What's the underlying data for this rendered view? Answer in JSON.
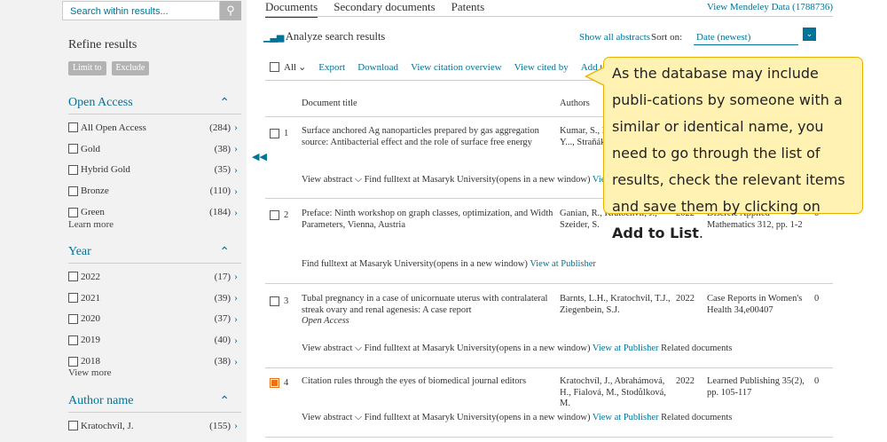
{
  "sidebar": {
    "search_placeholder": "Search within results...",
    "search_icon": "search-icon",
    "refine_title": "Refine results",
    "limit_to": "Limit to",
    "exclude": "Exclude",
    "open_access": {
      "title": "Open Access",
      "items": [
        {
          "label": "All Open Access",
          "count": "(284)"
        },
        {
          "label": "Gold",
          "count": "(38)"
        },
        {
          "label": "Hybrid Gold",
          "count": "(35)"
        },
        {
          "label": "Bronze",
          "count": "(110)"
        },
        {
          "label": "Green",
          "count": "(184)"
        }
      ],
      "more": "Learn more"
    },
    "year": {
      "title": "Year",
      "items": [
        {
          "label": "2022",
          "count": "(17)"
        },
        {
          "label": "2021",
          "count": "(39)"
        },
        {
          "label": "2020",
          "count": "(37)"
        },
        {
          "label": "2019",
          "count": "(40)"
        },
        {
          "label": "2018",
          "count": "(38)"
        }
      ],
      "more": "View more"
    },
    "author": {
      "title": "Author name",
      "items": [
        {
          "label": "Kratochvíl, J.",
          "count": "(155)"
        }
      ]
    }
  },
  "tabs": {
    "documents": "Documents",
    "secondary": "Secondary documents",
    "patents": "Patents",
    "mendeley": "View Mendeley Data (1788736)"
  },
  "analyze": "Analyze search results",
  "show_abstracts": "Show all abstracts",
  "sort_label": "Sort on:",
  "sort_value": "Date (newest)",
  "toolbar": {
    "all": "All",
    "export": "Export",
    "download": "Download",
    "citation_overview": "View citation overview",
    "cited_by": "View cited by",
    "add_to_list": "Add to List"
  },
  "columns": {
    "title": "Document title",
    "authors": "Authors"
  },
  "results": [
    {
      "num": "1",
      "title": "Surface anchored Ag nanoparticles prepared by gas aggregation source: Antibacterial effect and the role of surface free energy",
      "authors": "Kumar, S., Kr..., Mukhkrabi, Y..., Straňák, V.",
      "links": "View abstract ⌵  Find fulltext at Masaryk University(opens in a new window)",
      "link_view_pub": "View at P"
    },
    {
      "num": "2",
      "title": "Preface: Ninth workshop on graph classes, optimization, and Width Parameters, Vienna, Austria",
      "authors": "Ganian, R., Kratochvíl, J., Szeider, S.",
      "year": "2022",
      "source": "Discrete Applied Mathematics 312, pp. 1-2",
      "cited": "0",
      "links": "Find fulltext at Masaryk University(opens in a new window)",
      "link_view_pub": "View at Publisher"
    },
    {
      "num": "3",
      "title": "Tubal pregnancy in a case of unicornuate uterus with contralateral streak ovary and renal agenesis: A case report",
      "open_access": "Open Access",
      "authors": "Barnts, L.H., Kratochvil, T.J., Ziegenbein, S.J.",
      "year": "2022",
      "source": "Case Reports in Women's Health 34,e00407",
      "cited": "0",
      "links": "View abstract ⌵  Find fulltext at Masaryk University(opens in a new window)",
      "link_view_pub": "View at Publisher",
      "link_related": "Related documents"
    },
    {
      "num": "4",
      "title": "Citation rules through the eyes of biomedical journal editors",
      "authors": "Kratochvíl, J., Abrahámová, H., Fialová, M., Stodůlková, M.",
      "year": "2022",
      "source": "Learned Publishing 35(2), pp. 105-117",
      "cited": "0",
      "links": "View abstract ⌵  Find fulltext at Masaryk University(opens in a new window)",
      "link_view_pub": "View at Publisher",
      "link_related": "Related documents"
    }
  ],
  "callout": {
    "text": "As the database may include publi-cations by someone with a similar or identical name, you need to go through the list of results, check the relevant items and save them by clicking on ",
    "bold": "Add to List",
    "end": "."
  },
  "colors": {
    "accent": "#007398",
    "checked": "#e9711c",
    "callout_bg": "#fff2b3"
  }
}
